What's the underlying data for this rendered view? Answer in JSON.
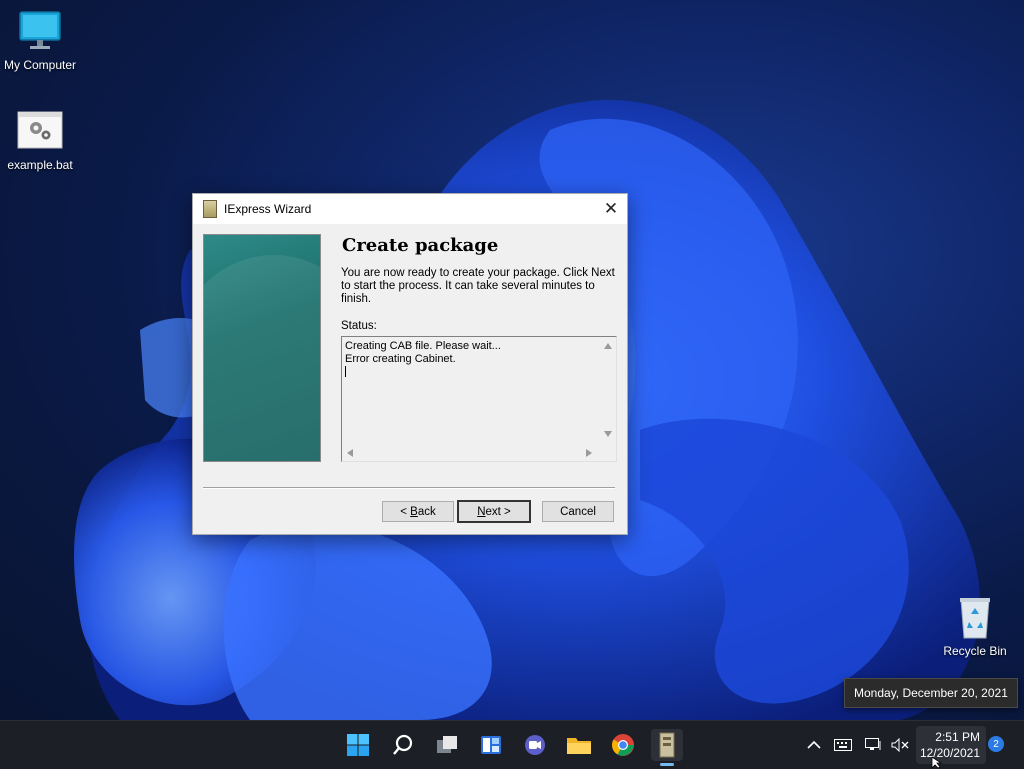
{
  "desktop": {
    "icons": [
      {
        "label": "My Computer"
      },
      {
        "label": "example.bat"
      },
      {
        "label": "Recycle Bin"
      }
    ]
  },
  "dialog": {
    "title": "IExpress Wizard",
    "heading": "Create package",
    "description": "You are now ready to create your package.  Click  Next to start the process.  It can take several minutes to finish.",
    "status_label": "Status:",
    "status_lines": [
      "Creating CAB file.  Please wait...",
      "Error creating Cabinet."
    ],
    "buttons": {
      "back_mnemonic": "B",
      "back_rest": "ack",
      "back_prefix": "< ",
      "next_mnemonic": "N",
      "next_rest": "ext >",
      "cancel": "Cancel"
    }
  },
  "tooltip": "Monday, December 20, 2021",
  "taskbar": {
    "pinned": [
      "start-icon",
      "search-icon",
      "task-view-icon",
      "widgets-icon",
      "teams-chat-icon",
      "file-explorer-icon",
      "chrome-icon",
      "iexpress-icon"
    ],
    "clock_time": "2:51 PM",
    "clock_date": "12/20/2021",
    "notification_count": "2"
  },
  "colors": {
    "accent": "#76b9ed",
    "taskbar_bg": "#1c1f26",
    "wizard_panel": "#1b6f6c"
  }
}
